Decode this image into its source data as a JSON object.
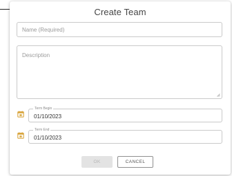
{
  "dialog": {
    "title": "Create Team"
  },
  "form": {
    "name": {
      "placeholder": "Name (Required)",
      "value": ""
    },
    "description": {
      "placeholder": "Description",
      "value": ""
    },
    "term_begin": {
      "label": "Term Begin",
      "value": "01/10/2023",
      "icon": "calendar-icon"
    },
    "term_end": {
      "label": "Term End",
      "value": "01/10/2023",
      "icon": "calendar-icon"
    }
  },
  "actions": {
    "ok_label": "OK",
    "cancel_label": "CANCEL",
    "ok_disabled": true
  },
  "colors": {
    "calendar_icon": "#d9a640",
    "ok_disabled_bg": "#e3e3e3",
    "ok_disabled_text": "#b4b4b4",
    "field_border": "#c9c9c9"
  }
}
